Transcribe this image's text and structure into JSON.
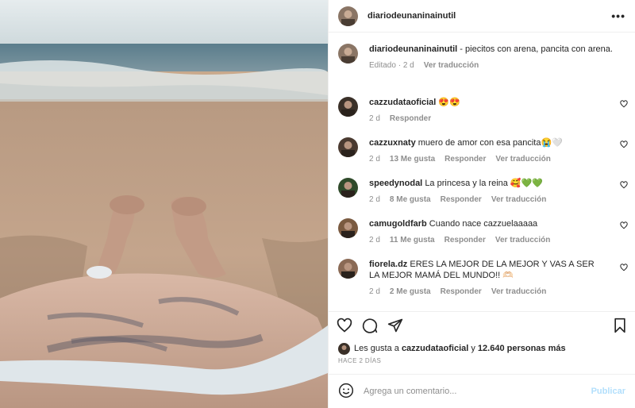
{
  "post": {
    "username": "diariodeunaninainutil",
    "more_icon": "more-horizontal-icon"
  },
  "caption": {
    "username": "diariodeunaninainutil",
    "text": " - piecitos con arena, pancita con arena.",
    "edited": "Editado",
    "time": "2 d",
    "translate": "Ver traducción"
  },
  "comments": [
    {
      "username": "cazzudataoficial",
      "text": "😍😍",
      "time": "2 d",
      "likes": "",
      "reply": "Responder",
      "translate": "",
      "avatar_color": "#3a3028"
    },
    {
      "username": "cazzuxnaty",
      "text": "muero de amor con esa pancita😭🤍",
      "time": "2 d",
      "likes": "13 Me gusta",
      "reply": "Responder",
      "translate": "Ver traducción",
      "avatar_color": "#4a3a30"
    },
    {
      "username": "speedynodal",
      "text": "La princesa y la reina 🥰💚💚",
      "time": "2 d",
      "likes": "8 Me gusta",
      "reply": "Responder",
      "translate": "Ver traducción",
      "avatar_color": "#2f4a2a"
    },
    {
      "username": "camugoldfarb",
      "text": "Cuando nace cazzuelaaaaa",
      "time": "2 d",
      "likes": "11 Me gusta",
      "reply": "Responder",
      "translate": "Ver traducción",
      "avatar_color": "#7a5a40"
    },
    {
      "username": "fiorela.dz",
      "text": "ERES LA MEJOR DE LA MEJOR Y VAS A SER LA MEJOR MAMÁ DEL MUNDO!! 🫶🏻",
      "time": "2 d",
      "likes": "2 Me gusta",
      "reply": "Responder",
      "translate": "Ver traducción",
      "avatar_color": "#8a6a55"
    }
  ],
  "likes": {
    "prefix": "Les gusta a ",
    "user": "cazzudataoficial",
    "middle": " y ",
    "count": "12.640 personas más"
  },
  "date": "HACE 2 DÍAS",
  "add_comment": {
    "placeholder": "Agrega un comentario...",
    "publish": "Publicar"
  }
}
